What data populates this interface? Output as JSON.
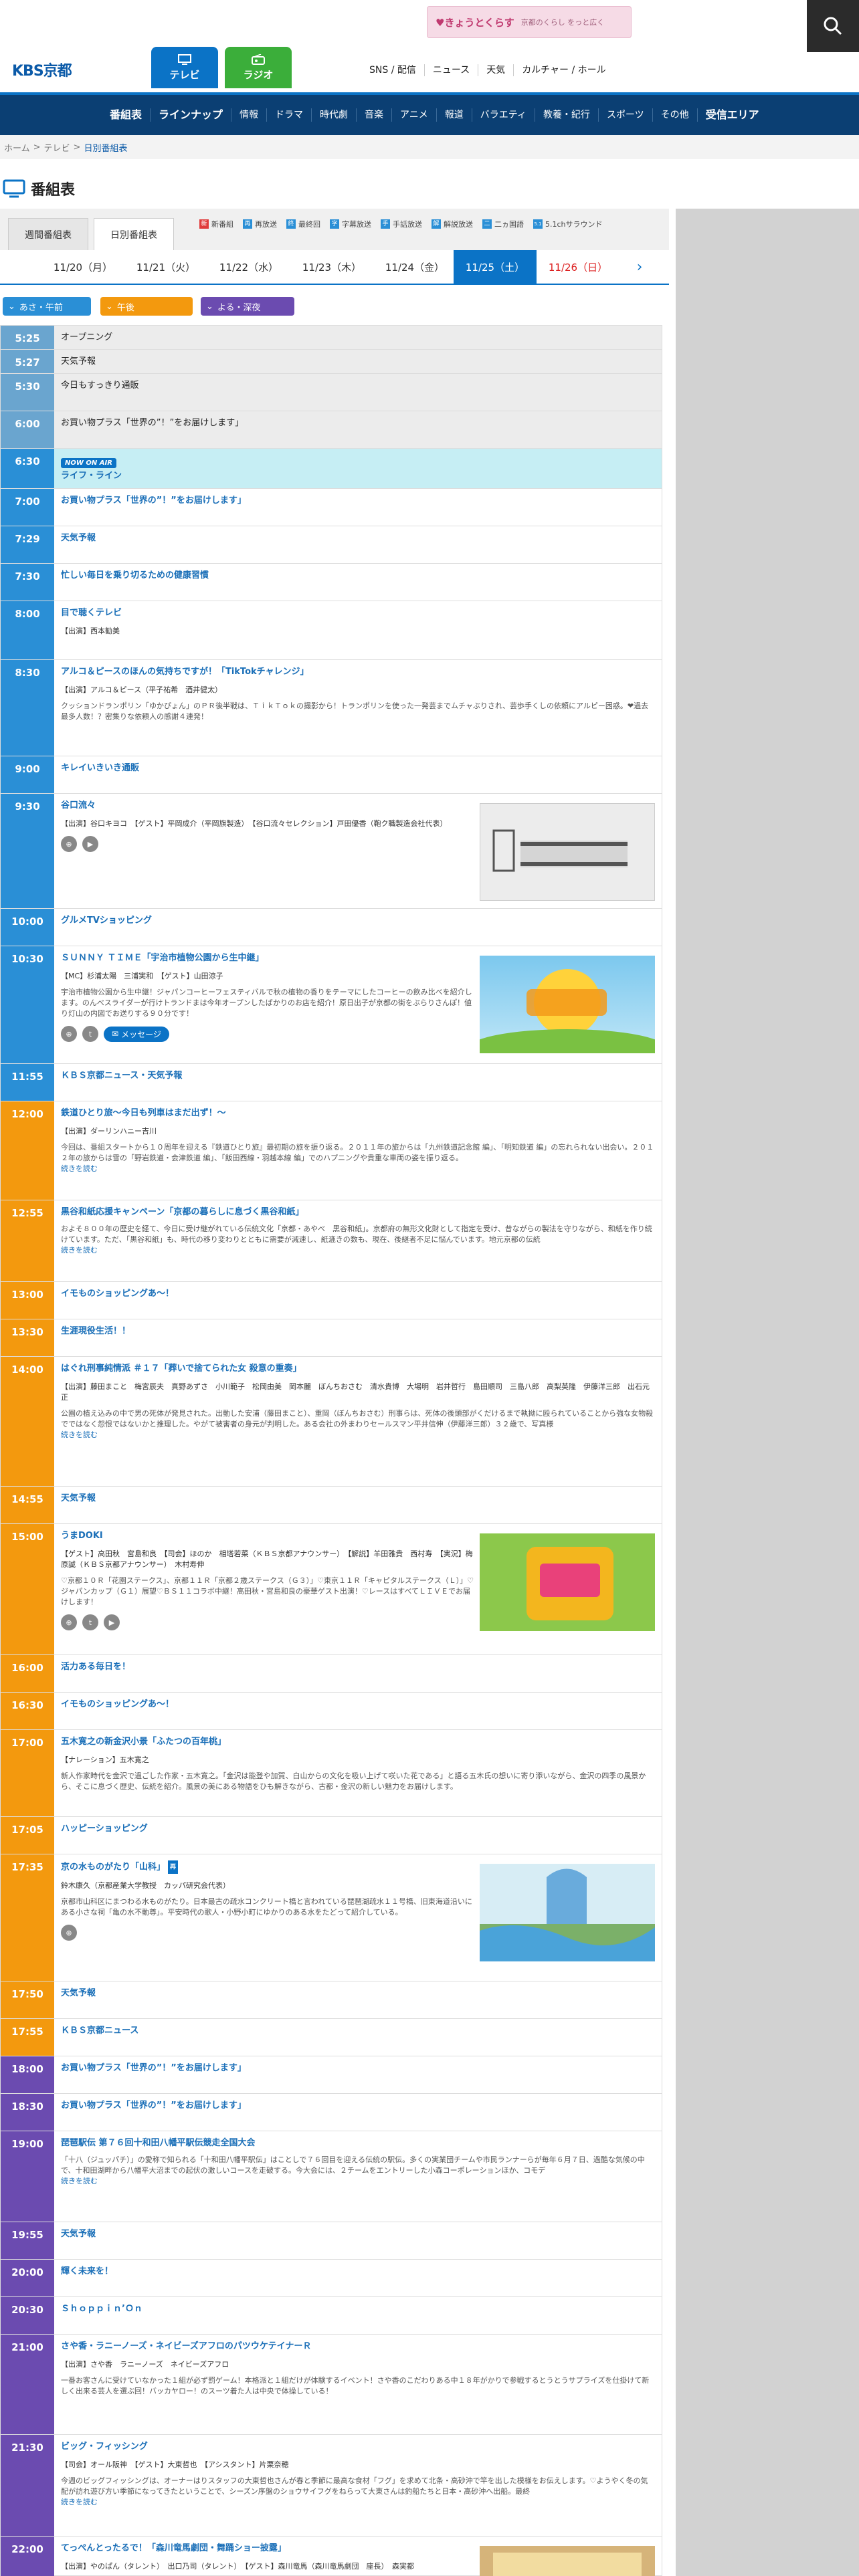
{
  "header": {
    "banner_main": "♥きょうとくらす",
    "banner_sub": "京都のくらし をっと広く",
    "logo": "KBS京都",
    "tab_tv": "テレビ",
    "tab_radio": "ラジオ",
    "links": [
      "SNS / 配信",
      "ニュース",
      "天気",
      "カルチャー / ホール"
    ]
  },
  "nav": {
    "items": [
      "番組表",
      "ラインナップ",
      "情報",
      "ドラマ",
      "時代劇",
      "音楽",
      "アニメ",
      "報道",
      "バラエティ",
      "教養・紀行",
      "スポーツ",
      "その他",
      "受信エリア"
    ]
  },
  "breadcrumb": {
    "home": "ホーム",
    "tv": "テレビ",
    "current": "日別番組表",
    "sep": ">"
  },
  "page": {
    "title": "番組表"
  },
  "tabs": {
    "weekly": "週間番組表",
    "daily": "日別番組表"
  },
  "legend": [
    {
      "mark": "新",
      "label": "新番組",
      "color": "#e03b3b"
    },
    {
      "mark": "再",
      "label": "再放送",
      "color": "#2a8fd6"
    },
    {
      "mark": "終",
      "label": "最終回",
      "color": "#2a8fd6"
    },
    {
      "mark": "字",
      "label": "字幕放送",
      "color": "#2a8fd6"
    },
    {
      "mark": "手",
      "label": "手話放送",
      "color": "#2a8fd6"
    },
    {
      "mark": "解",
      "label": "解説放送",
      "color": "#2a8fd6"
    },
    {
      "mark": "二",
      "label": "二ヵ国語",
      "color": "#2a8fd6"
    },
    {
      "mark": "5.1",
      "label": "5.1chサラウンド",
      "color": "#2a8fd6"
    }
  ],
  "dates": [
    "11/20（月）",
    "11/21（火）",
    "11/22（水）",
    "11/23（木）",
    "11/24（金）",
    "11/25（土）",
    "11/26（日）"
  ],
  "slots": [
    "あさ・午前",
    "午後",
    "よる・深夜"
  ],
  "now_label": "NOW ON AIR",
  "more_label": "続きを読む",
  "message_label": "メッセージ",
  "programs": [
    {
      "time": "5:25",
      "title": "オープニング"
    },
    {
      "time": "5:27",
      "title": "天気予報"
    },
    {
      "time": "5:30",
      "title": "今日もすっきり通販"
    },
    {
      "time": "6:00",
      "title": "お買い物プラス「世界の”！”をお届けします」"
    },
    {
      "time": "6:30",
      "title": "ライフ・ライン"
    },
    {
      "time": "7:00",
      "title": "お買い物プラス「世界の”！”をお届けします」"
    },
    {
      "time": "7:29",
      "title": "天気予報"
    },
    {
      "time": "7:30",
      "title": "忙しい毎日を乗り切るための健康習慣"
    },
    {
      "time": "8:00",
      "title": "目で聴くテレビ",
      "cast": "【出演】西本勧美"
    },
    {
      "time": "8:30",
      "title": "アルコ＆ピースのほんの気持ちですが！「TikTokチャレンジ」",
      "cast": "【出演】アルコ＆ピース（平子祐希　酒井健太）",
      "desc": "クッションドランポリン「ゆかぴょん」のＰＲ後半戦は、ＴｉｋＴｏｋの撮影から！トランポリンを使った一発芸までムチャぶりされ、芸歩手くしの依頼にアルピー困惑。❤過去最多人数！？密集りな依頼人の感謝４連発！"
    },
    {
      "time": "9:00",
      "title": "キレイいきいき通販"
    },
    {
      "time": "9:30",
      "title": "谷口流々",
      "cast": "【出演】谷口キヨコ　【ゲスト】平岡成介（平岡旗製造）　【谷口流々セレクション】戸田優香（鞄ク職製造会社代表）"
    },
    {
      "time": "10:00",
      "title": "グルメTVショッピング"
    },
    {
      "time": "10:30",
      "title": "ＳＵＮＮＹ ＴＩＭＥ「宇治市植物公園から生中継」",
      "cast": "【MC】杉浦太陽　三浦実和　【ゲスト】山田涼子",
      "desc": "宇治市植物公園から生中継！ジャパンコーヒーフェスティバルで秋の植物の香りをテーマにしたコーヒーの飲み比べを紹介します。のんべスライダーが行けトランドまは今年オープンしたばかりのお店を紹介！原日出子が京都の街をぶらりさんぽ！値り灯山の内図でお送りする９０分です！"
    },
    {
      "time": "11:55",
      "title": "ＫＢＳ京都ニュース・天気予報"
    },
    {
      "time": "12:00",
      "title": "鉄道ひとり旅～今日も列車はまだ出ず！～",
      "cast": "【出演】ダーリンハニー吉川",
      "desc": "今回は、番組スタートから１０周年を迎える『鉄道ひとり旅』最初期の旅を振り返る。２０１１年の旅からは「九州鉄道記念館 編」、「明知鉄道 編」の忘れられない出会い。２０１２年の旅からは雪の「野岩鉄道・会津鉄道 編」、「飯田西線・羽越本線 編」でのハプニングや貴重な車両の姿を振り返る。"
    },
    {
      "time": "12:55",
      "title": "黒谷和紙応援キャンペーン「京都の暮らしに息づく黒谷和紙」",
      "desc": "およそ８００年の歴史を経て、今日に受け継がれている伝統文化「京都・あやべ　黒谷和紙」。京都府の無形文化財として指定を受け、昔ながらの製法を守りながら、和紙を作り続けています。ただ、「黒谷和紙」も、時代の移り変わりとともに需要が減速し、紙漉きの数も、現在、後継者不足に悩んでいます。地元京都の伝統"
    },
    {
      "time": "13:00",
      "title": "イモものショッピングあ～！"
    },
    {
      "time": "13:30",
      "title": "生涯現役生活！！"
    },
    {
      "time": "14:00",
      "title": "はぐれ刑事純情派 ＃１７「葬いで捨てられた女 殺意の重奏」",
      "cast": "【出演】藤田まこと　梅宮辰夫　真野あずさ　小川範子　松岡由美　岡本麗　ぼんちおさむ　清水貴博　大場明　岩井哲行　島田順司　三島八郎　高梨英隆　伊藤洋三郎　出石元正",
      "desc": "公園の植え込みの中で男の死体が発見された。出動した安浦（藤田まこと）、重岡（ぼんちおさむ）刑事らは、死体の後頭部がくだけるまで執拗に殴られていることから強な女物殺でではなく怨恨ではないかと推理した。やがて被害者の身元が判明した。ある会社の外まわりセールスマン平井信伸（伊藤洋三郎）３２歳で、写真様"
    },
    {
      "time": "14:55",
      "title": "天気予報"
    },
    {
      "time": "15:00",
      "title": "うまDOKI",
      "cast": "【ゲスト】高田秋　宮島和良　【司会】ほのか　相塔若菜（ＫＢＳ京都アナウンサー）　【解説】羊田雅貴　西村寿　【実況】梅原誠（ＫＢＳ京都アナウンサー）　木村寿伸",
      "desc": "♡京都１０Ｒ「花園ステークス」、京都１１Ｒ「京都２歳ステークス（Ｇ３）」♡東京１１Ｒ「キャピタルステークス（Ｌ）」♡ジャパンカップ（Ｇ１）展望♡ＢＳ１１コラボ中継！高田秋・宮島和良の豪華ゲスト出演！♡レースはすべてＬＩＶＥでお届けします！"
    },
    {
      "time": "16:00",
      "title": "活力ある毎日を！"
    },
    {
      "time": "16:30",
      "title": "イモものショッピングあ～！"
    },
    {
      "time": "17:00",
      "title": "五木寛之の新金沢小景「ふたつの百年桃」",
      "cast": "【ナレーション】五木寛之",
      "desc": "新人作家時代を金沢で過ごした作家・五木寛之。「金沢は能登や加賀、白山からの文化を吸い上げて咲いた花である」と語る五木氏の想いに寄り添いながら、金沢の四季の風景から、そこに息づく歴史、伝統を紹介。風景の美にある物語をひも解きながら、古都・金沢の新しい魅力をお届けします。"
    },
    {
      "time": "17:05",
      "title": "ハッピーショッピング"
    },
    {
      "time": "17:35",
      "title": "京の水ものがたり「山科」",
      "cast": "鈴木康久（京都産業大学教授　カッパ研究会代表）",
      "desc": "京都市山科区にまつわる水ものがたり。日本最古の疏水コンクリート橋と言われている琵琶湖疏水１１号橋、旧東海道沿いにある小さな祠「亀の水不動尊」。平安時代の歌人・小野小町にゆかりのある水をたどって紹介している。"
    },
    {
      "time": "17:50",
      "title": "天気予報"
    },
    {
      "time": "17:55",
      "title": "ＫＢＳ京都ニュース"
    },
    {
      "time": "18:00",
      "title": "お買い物プラス「世界の”！”をお届けします」"
    },
    {
      "time": "18:30",
      "title": "お買い物プラス「世界の”！”をお届けします」"
    },
    {
      "time": "19:00",
      "title": "琵琶駅伝 第７６回十和田八幡平駅伝競走全国大会",
      "desc": "「十八（ジュッパチ）」の愛称で知られる「十和田八幡平駅伝」はことしで７６回目を迎える伝統の駅伝。多くの実業団チームや市民ランナーらが毎年６月７日、過酷な気候の中で、十和田湖畔から八幡平大沼までの起伏の激しいコースを走破する。今大会には、２チームをエントリーした小森コーポレーションほか、コモデ"
    },
    {
      "time": "19:55",
      "title": "天気予報"
    },
    {
      "time": "20:00",
      "title": "輝く未来を！"
    },
    {
      "time": "20:30",
      "title": "Ｓｈｏｐｐｉｎ’Ｏｎ"
    },
    {
      "time": "21:00",
      "title": "さや香・ラニーノーズ・ネイビーズアフロのパツウケテイナーＲ",
      "cast": "【出演】さや香　ラニーノーズ　ネイビーズアフロ",
      "desc": "一番お客さんに受けていなかった１組が必ず罰ゲーム！本格派と１組だけが体験するイベント！さや香のこだわりある中１８年がかりで参戦するとうとうサプライズを仕掛けて新しく出来る芸人を選ぶ回！バッカヤロー！のスーツ着た人は中央で体操している！"
    },
    {
      "time": "21:30",
      "title": "ビッグ・フィッシング",
      "cast": "【司会】オール阪神　【ゲスト】大東哲也　【アシスタント】片栗奈穂",
      "desc": "今週のビッグフィッシングは、オーナーはりスタッフの大東哲也さんが春と季節に最高な食材「フグ」を求めて北条・高砂沖で竿を出した模様をお伝えします。♡ようやく冬の気配が訪れ遊び方い季節になってきたということで、シーズン序盤のショウサイフグをねらって大東さんは釣船たちと日本・高砂沖へ出船。最終"
    },
    {
      "time": "22:00",
      "title": "てっぺんとったるで！「森川竜馬劇団・舞踊ショー披露」",
      "cast": "【出演】やのぱん（タレント）　出口乃司（タレント）　【ゲスト】森川竜馬（森川竜馬劇団　座長）　森実都"
    }
  ]
}
